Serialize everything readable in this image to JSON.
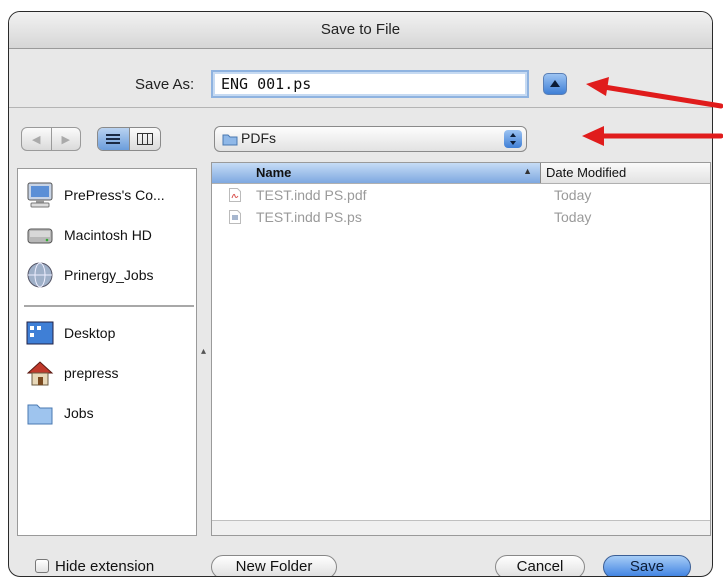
{
  "dialog": {
    "title": "Save to File",
    "save_as_label": "Save As:",
    "save_as_value": "ENG 001.ps",
    "folder": "PDFs"
  },
  "sidebar": {
    "devices": [
      {
        "label": "PrePress's Co...",
        "icon": "computer-icon"
      },
      {
        "label": "Macintosh HD",
        "icon": "hard-drive-icon"
      },
      {
        "label": "Prinergy_Jobs",
        "icon": "network-volume-icon"
      }
    ],
    "places": [
      {
        "label": "Desktop",
        "icon": "desktop-icon"
      },
      {
        "label": "prepress",
        "icon": "home-icon"
      },
      {
        "label": "Jobs",
        "icon": "folder-icon"
      }
    ]
  },
  "file_list": {
    "columns": [
      "Name",
      "Date Modified"
    ],
    "rows": [
      {
        "name": "TEST.indd PS.pdf",
        "date": "Today",
        "icon": "pdf-file-icon"
      },
      {
        "name": "TEST.indd PS.ps",
        "date": "Today",
        "icon": "ps-file-icon"
      }
    ]
  },
  "footer": {
    "hide_extension_label": "Hide extension",
    "new_folder_label": "New Folder",
    "cancel_label": "Cancel",
    "save_label": "Save"
  },
  "colors": {
    "accent_blue": "#3f7fd6",
    "arrow_red": "#e01c1c"
  }
}
